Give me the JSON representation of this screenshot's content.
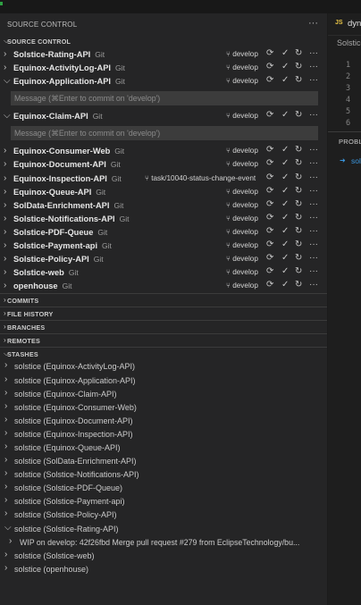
{
  "sidebar": {
    "title": "SOURCE CONTROL",
    "more": "···",
    "source_control_section": "SOURCE CONTROL",
    "commit_placeholder": "Message (⌘Enter to commit on 'develop')",
    "sections": {
      "commits": "COMMITS",
      "file_history": "FILE HISTORY",
      "branches": "BRANCHES",
      "remotes": "REMOTES",
      "stashes": "STASHES"
    },
    "repos": [
      {
        "name": "Solstice-Rating-API",
        "tag": "Git",
        "branch": "develop",
        "expanded": false
      },
      {
        "name": "Equinox-ActivityLog-API",
        "tag": "Git",
        "branch": "develop",
        "expanded": false
      },
      {
        "name": "Equinox-Application-API",
        "tag": "Git",
        "branch": "develop",
        "expanded": true
      },
      {
        "name": "Equinox-Claim-API",
        "tag": "Git",
        "branch": "develop",
        "expanded": true
      },
      {
        "name": "Equinox-Consumer-Web",
        "tag": "Git",
        "branch": "develop",
        "expanded": false
      },
      {
        "name": "Equinox-Document-API",
        "tag": "Git",
        "branch": "develop",
        "expanded": false
      },
      {
        "name": "Equinox-Inspection-API",
        "tag": "Git",
        "branch": "task/10040-status-change-event",
        "expanded": false
      },
      {
        "name": "Equinox-Queue-API",
        "tag": "Git",
        "branch": "develop",
        "expanded": false
      },
      {
        "name": "SolData-Enrichment-API",
        "tag": "Git",
        "branch": "develop",
        "expanded": false
      },
      {
        "name": "Solstice-Notifications-API",
        "tag": "Git",
        "branch": "develop",
        "expanded": false
      },
      {
        "name": "Solstice-PDF-Queue",
        "tag": "Git",
        "branch": "develop",
        "expanded": false
      },
      {
        "name": "Solstice-Payment-api",
        "tag": "Git",
        "branch": "develop",
        "expanded": false
      },
      {
        "name": "Solstice-Policy-API",
        "tag": "Git",
        "branch": "develop",
        "expanded": false
      },
      {
        "name": "Solstice-web",
        "tag": "Git",
        "branch": "develop",
        "expanded": false
      },
      {
        "name": "openhouse",
        "tag": "Git",
        "branch": "develop",
        "expanded": false
      }
    ],
    "stashes": [
      "solstice (Equinox-ActivityLog-API)",
      "solstice (Equinox-Application-API)",
      "solstice (Equinox-Claim-API)",
      "solstice (Equinox-Consumer-Web)",
      "solstice (Equinox-Document-API)",
      "solstice (Equinox-Inspection-API)",
      "solstice (Equinox-Queue-API)",
      "solstice (SolData-Enrichment-API)",
      "solstice (Solstice-Notifications-API)",
      "solstice (Solstice-PDF-Queue)",
      "solstice (Solstice-Payment-api)",
      "solstice (Solstice-Policy-API)",
      "solstice (Solstice-Rating-API)",
      "solstice (Solstice-web)",
      "solstice (openhouse)"
    ],
    "wip": "WIP on develop: 42f26fbd Merge pull request #279 from EclipseTechnology/bu..."
  },
  "editor": {
    "tab_lang": "JS",
    "tab_name": "dyna",
    "breadcrumb": "Solstice",
    "line_numbers": [
      "1",
      "2",
      "3",
      "4",
      "5",
      "6"
    ],
    "panel_title": "PROBLEMS",
    "panel_item": "sol"
  },
  "colors": {
    "background": "#1e1e1e",
    "sidebar": "#252526",
    "input": "#3c3c3c",
    "js_badge": "#e8c547",
    "link": "#3a96dd"
  }
}
